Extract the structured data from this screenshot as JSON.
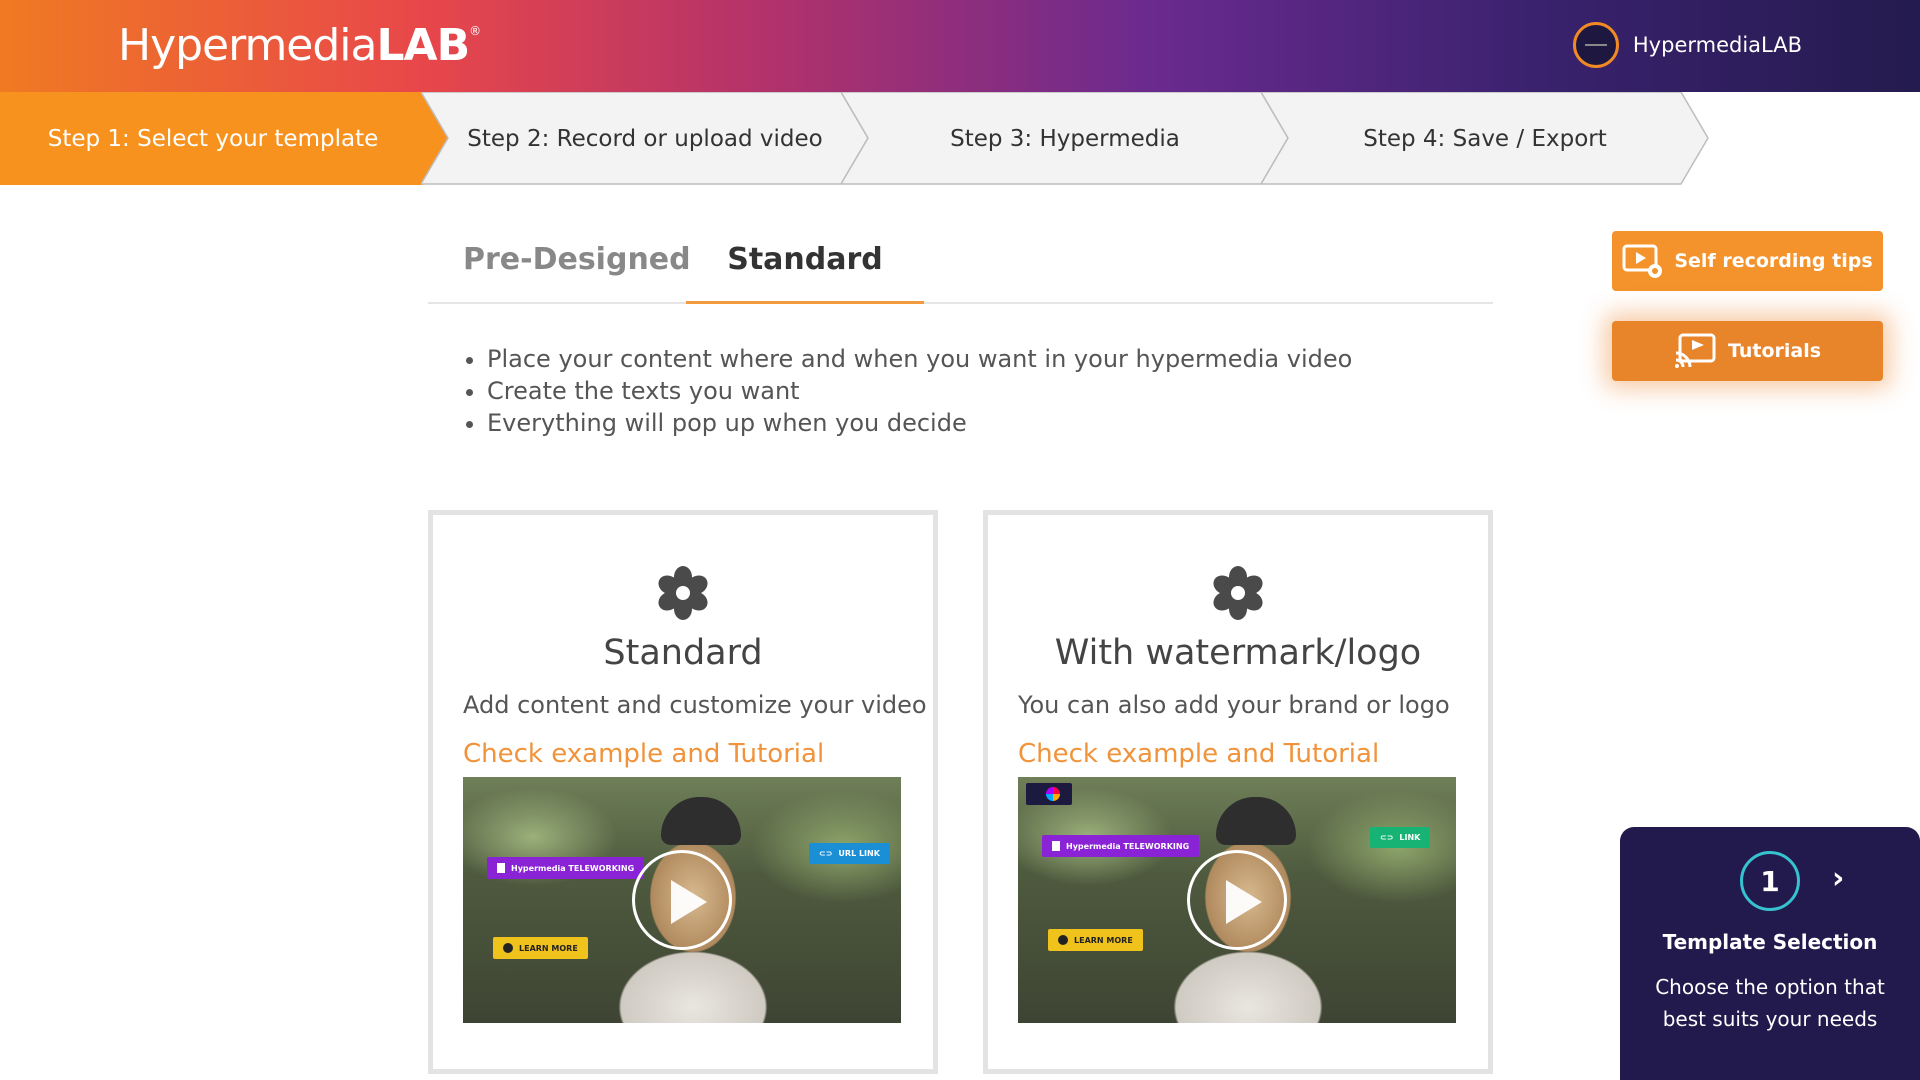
{
  "header": {
    "logo_light": "Hypermedia",
    "logo_bold": "LAB",
    "logo_mark": "®",
    "user_name": "HypermediaLAB"
  },
  "steps": [
    {
      "label": "Step 1: Select your template",
      "active": true
    },
    {
      "label": "Step 2: Record or upload video",
      "active": false
    },
    {
      "label": "Step 3: Hypermedia",
      "active": false
    },
    {
      "label": "Step 4: Save / Export",
      "active": false
    }
  ],
  "tabs": {
    "pre_designed": "Pre-Designed",
    "standard": "Standard",
    "selected": "Standard"
  },
  "bullets": [
    "Place your content where and when you want in your hypermedia video",
    "Create the texts you want",
    "Everything will pop up when you decide"
  ],
  "cards": [
    {
      "icon": "flower-icon",
      "title": "Standard",
      "description": "Add content and customize your video",
      "link": "Check example and Tutorial",
      "chips": {
        "doc": "Hypermedia TELEWORKING",
        "url": "URL LINK",
        "cta": "LEARN MORE"
      }
    },
    {
      "icon": "flower-icon",
      "title": "With watermark/logo",
      "description": "You can also add your brand or logo",
      "link": "Check example and Tutorial",
      "chips": {
        "doc": "Hypermedia TELEWORKING",
        "url": "LINK",
        "cta": "LEARN MORE"
      }
    }
  ],
  "side_buttons": {
    "self_recording": "Self recording tips",
    "tutorials": "Tutorials"
  },
  "guide": {
    "step_number": "1",
    "next": "›",
    "title": "Template Selection",
    "text": "Choose the option that best suits your needs"
  },
  "colors": {
    "accent": "#f4932b",
    "link": "#f0933a",
    "guide_bg": "#221a4c",
    "guide_ring": "#37c2d0"
  }
}
